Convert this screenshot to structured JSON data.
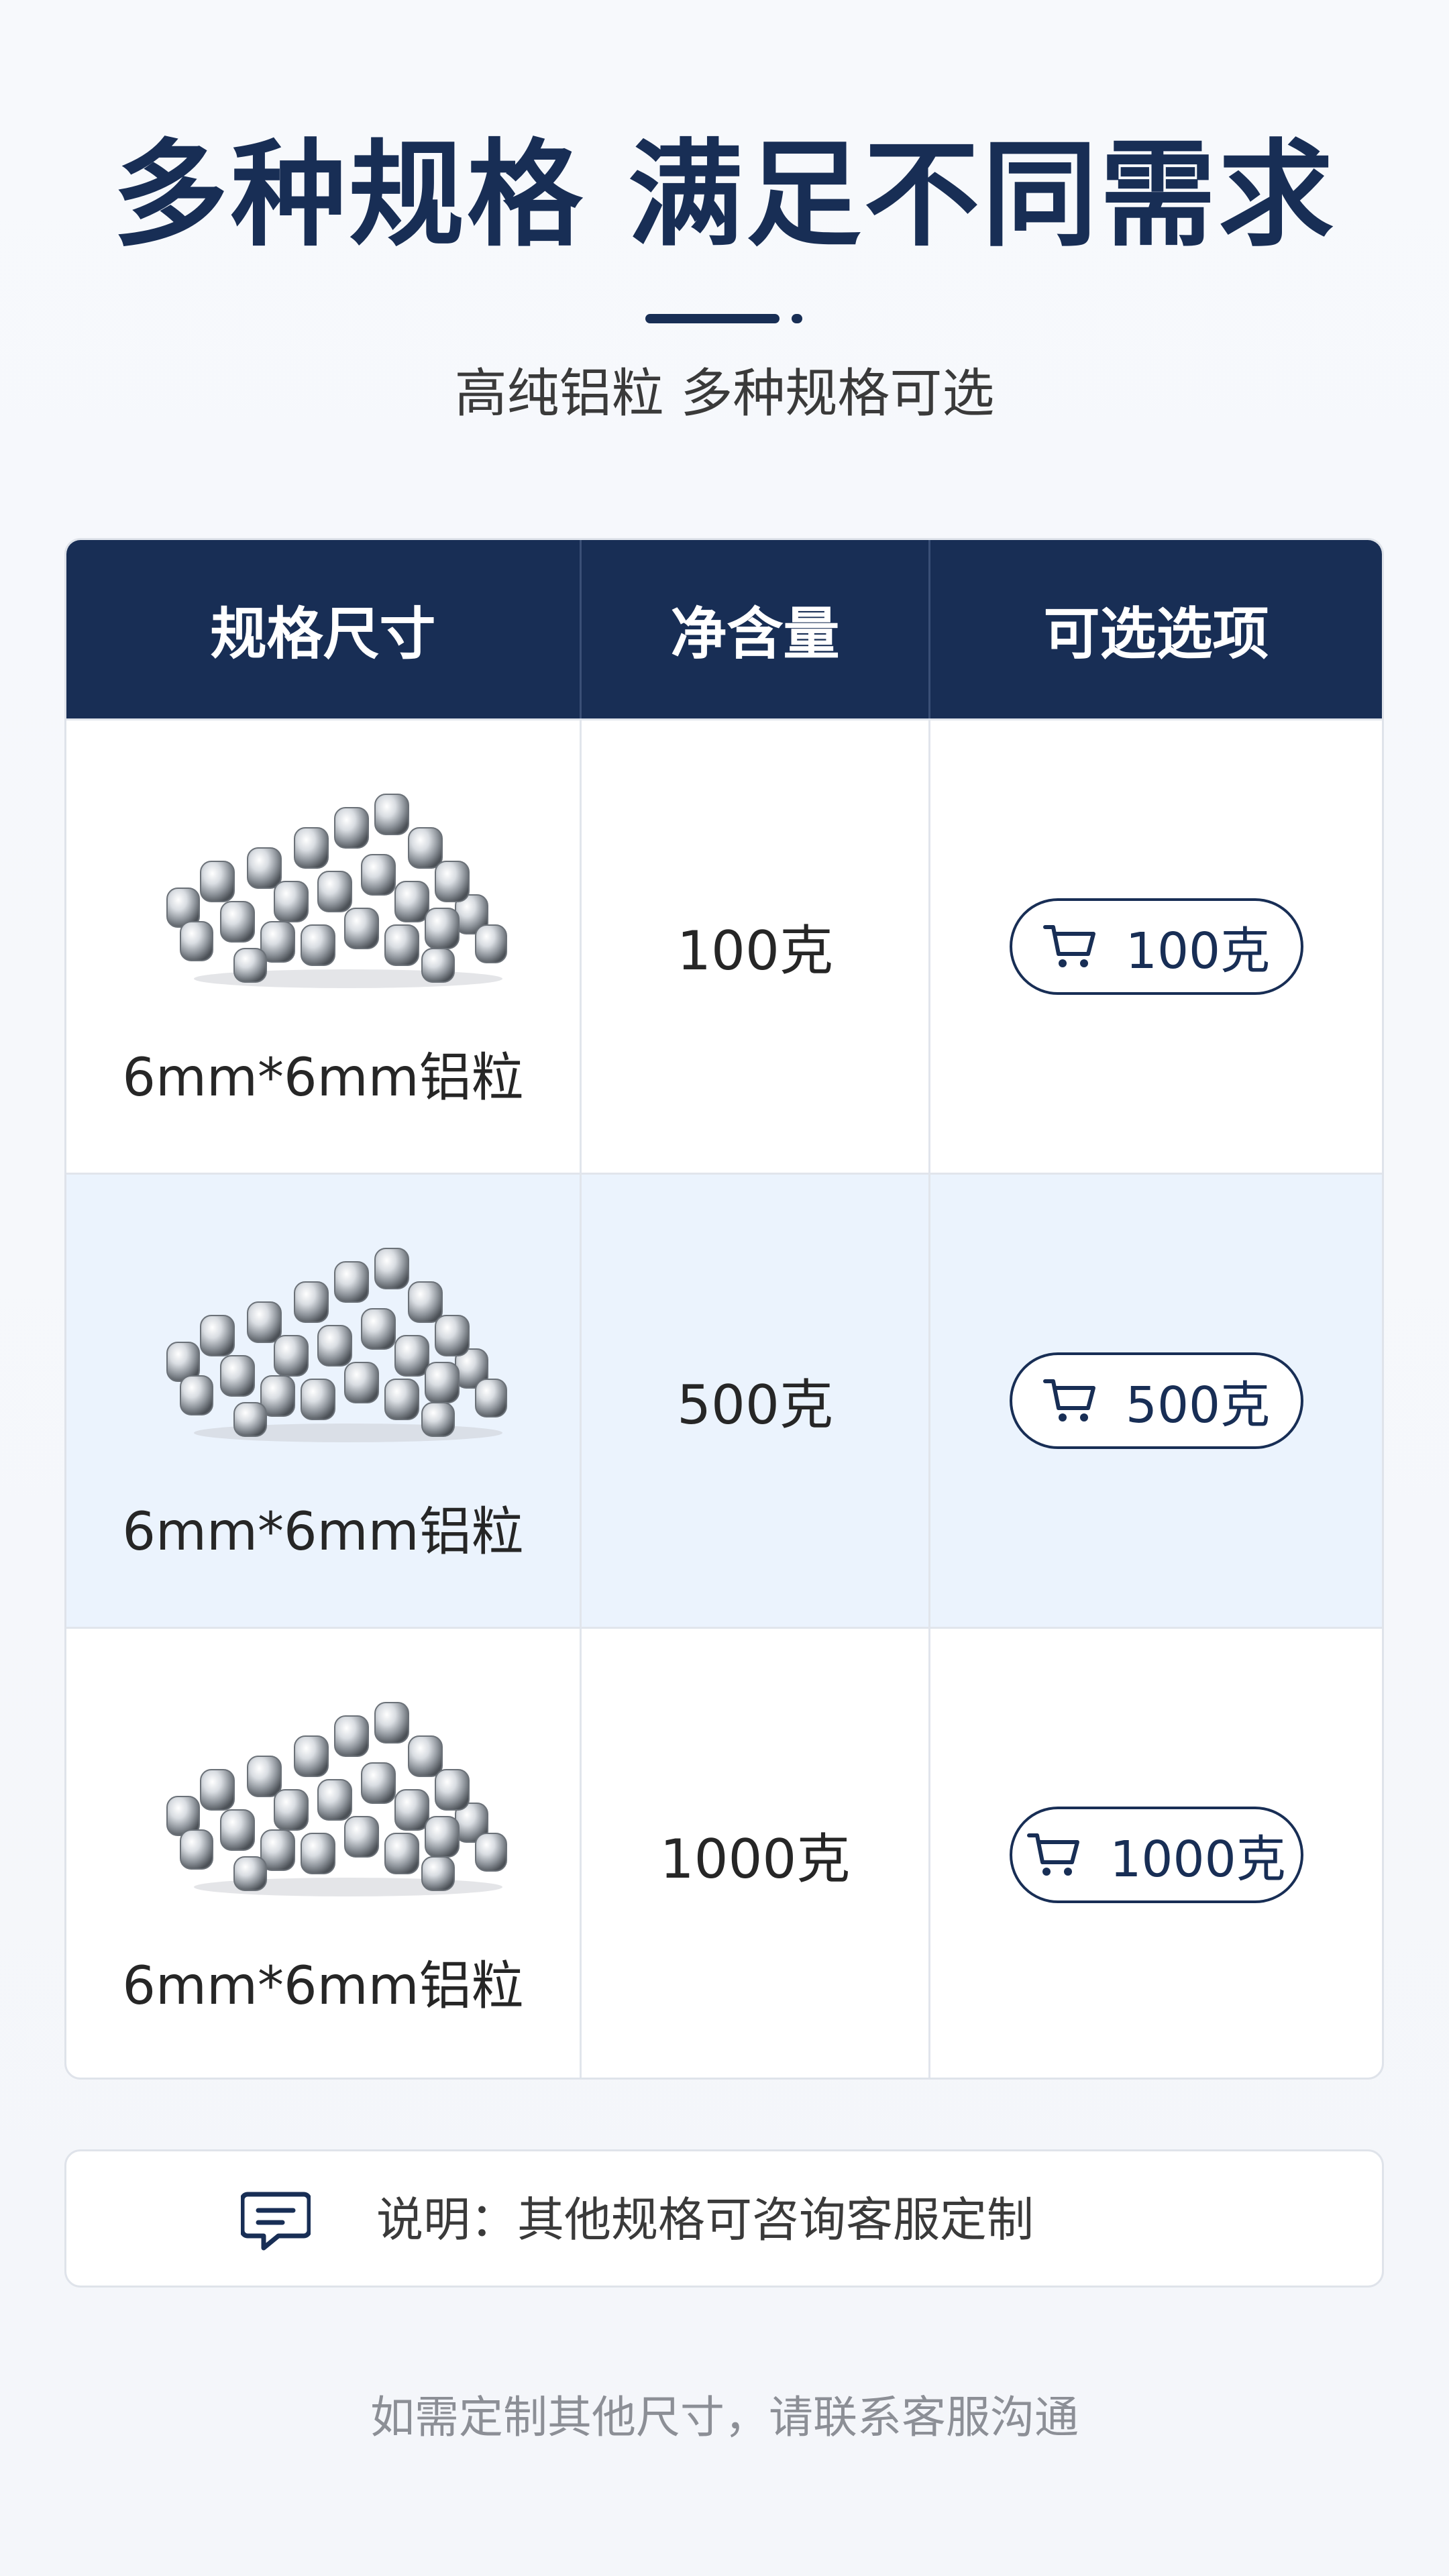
{
  "page": {
    "title": "多种规格 满足不同需求",
    "subtitle": "高纯铝粒  多种规格可选"
  },
  "colors": {
    "primary": "#182e55",
    "row_highlight": "#ebf3fd",
    "background": "#f5f7fa"
  },
  "table": {
    "headers": [
      "规格尺寸",
      "净含量",
      "可选选项"
    ],
    "rows": [
      {
        "image": "aluminum-pellets-image",
        "spec": "6mm*6mm铝粒",
        "weight": "100克",
        "option": "100克",
        "option_icon": "cart-icon"
      },
      {
        "image": "aluminum-pellets-image",
        "spec": "6mm*6mm铝粒",
        "weight": "500克",
        "option": "500克",
        "option_icon": "cart-icon"
      },
      {
        "image": "aluminum-pellets-image",
        "spec": "6mm*6mm铝粒",
        "weight": "1000克",
        "option": "1000克",
        "option_icon": "cart-icon"
      }
    ]
  },
  "note": {
    "icon": "chat-bubble-icon",
    "text": "说明：其他规格可咨询客服定制"
  },
  "footer": {
    "text": "如需定制其他尺寸，请联系客服沟通"
  }
}
